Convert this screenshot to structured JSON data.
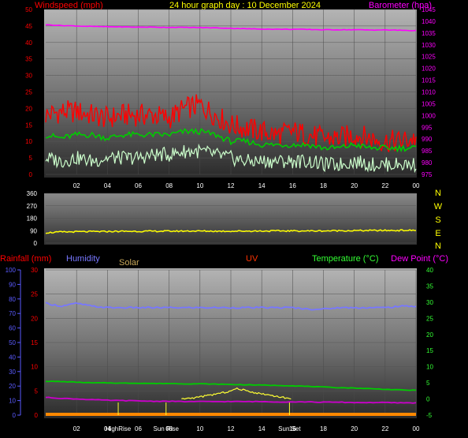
{
  "header": {
    "title": "24 hour graph day : 10 December 2024",
    "windspeed_label": "Windspeed (mph)",
    "barometer_label": "Barometer (hpa)"
  },
  "direction_letters": [
    "N",
    "W",
    "S",
    "E",
    "N"
  ],
  "lower_header": {
    "rainfall": "Rainfall (mm)",
    "humidity": "Humidity",
    "solar": "Solar",
    "uv": "UV",
    "temperature": "Temperature (°C)",
    "dewpoint": "Dew Point (°C)"
  },
  "colors": {
    "windspeed": "#ff0000",
    "gust": "#ff0000",
    "wind_avg": "#00cc00",
    "wind_low": "#ccffcc",
    "barometer": "#ff00ff",
    "direction": "#ffff00",
    "humidity": "#7777ff",
    "temperature": "#00cc00",
    "dewpoint": "#cc00cc",
    "solar": "#ffff33",
    "uv": "#ff0000",
    "rain": "#ff8800",
    "header_title": "#ffff00",
    "axis_tick": "#ffffff"
  },
  "x_ticks": [
    "02",
    "04",
    "06",
    "08",
    "10",
    "12",
    "14",
    "16",
    "18",
    "20",
    "22",
    "00"
  ],
  "chart_data": [
    {
      "type": "line",
      "title": "24 hour graph day : 10 December 2024",
      "ylabel_left": "Windspeed (mph)",
      "ylabel_right": "Barometer (hpa)",
      "ylim_left": [
        0,
        50
      ],
      "ylim_right": [
        975,
        1045
      ],
      "left_ticks": [
        0,
        5,
        10,
        15,
        20,
        25,
        30,
        35,
        40,
        45,
        50
      ],
      "right_ticks": [
        975,
        980,
        985,
        990,
        995,
        1000,
        1005,
        1010,
        1015,
        1020,
        1025,
        1030,
        1035,
        1040,
        1045
      ],
      "x_hours": [
        0,
        1,
        2,
        3,
        4,
        5,
        6,
        7,
        8,
        9,
        10,
        11,
        12,
        13,
        14,
        15,
        16,
        17,
        18,
        19,
        20,
        21,
        22,
        23,
        24
      ],
      "series": [
        {
          "values": [
            18,
            19,
            19,
            18,
            17,
            18,
            18,
            18,
            17,
            20,
            21,
            18,
            15,
            14,
            13,
            12,
            13,
            12,
            11,
            11,
            12,
            11,
            10,
            10,
            11
          ]
        },
        {
          "values": [
            12,
            11,
            12,
            12,
            11,
            12,
            12,
            12,
            12,
            13,
            13,
            12,
            10,
            10,
            9,
            9,
            9,
            9,
            8,
            8,
            9,
            8,
            8,
            8,
            8
          ]
        },
        {
          "values": [
            5,
            4,
            5,
            4,
            5,
            5,
            5,
            6,
            6,
            7,
            7,
            6,
            5,
            4,
            4,
            4,
            4,
            4,
            3,
            3,
            4,
            3,
            3,
            3,
            3
          ]
        },
        {
          "values": [
            1038.5,
            1038.2,
            1038.0,
            1037.8,
            1037.7,
            1037.6,
            1037.5,
            1037.5,
            1037.4,
            1037.4,
            1037.3,
            1037.2,
            1037.0,
            1036.8,
            1036.7,
            1036.6,
            1036.6,
            1036.5,
            1036.4,
            1036.4,
            1036.4,
            1036.3,
            1036.3,
            1036.2,
            1036.0
          ]
        }
      ]
    },
    {
      "type": "line",
      "ylim": [
        0,
        360
      ],
      "ticks": [
        0,
        90,
        180,
        270,
        360
      ],
      "x_hours": [
        0,
        1,
        2,
        3,
        4,
        5,
        6,
        7,
        8,
        9,
        10,
        11,
        12,
        13,
        14,
        15,
        16,
        17,
        18,
        19,
        20,
        21,
        22,
        23,
        24
      ],
      "series": [
        {
          "values": [
            75,
            80,
            82,
            83,
            84,
            85,
            85,
            86,
            86,
            87,
            87,
            86,
            86,
            87,
            87,
            88,
            88,
            88,
            88,
            90,
            90,
            91,
            91,
            92,
            92
          ]
        }
      ]
    },
    {
      "type": "line",
      "axes": {
        "humidity": {
          "ylim": [
            0,
            100
          ],
          "ticks": [
            0,
            10,
            20,
            30,
            40,
            50,
            60,
            70,
            80,
            90,
            100
          ]
        },
        "rainfall": {
          "ylim": [
            0,
            30
          ],
          "ticks": [
            0,
            5,
            10,
            15,
            20,
            25,
            30
          ]
        },
        "temperature": {
          "ylim": [
            -5,
            40
          ],
          "ticks": [
            -5,
            0,
            5,
            10,
            15,
            20,
            25,
            30,
            35,
            40
          ]
        }
      },
      "x_hours": [
        0,
        1,
        2,
        3,
        4,
        5,
        6,
        7,
        8,
        9,
        10,
        11,
        12,
        13,
        14,
        15,
        16,
        17,
        18,
        19,
        20,
        21,
        22,
        23,
        24
      ],
      "series": [
        {
          "values": [
            77,
            75,
            77,
            75,
            74,
            74,
            74,
            74,
            74,
            74,
            74,
            74,
            74,
            74,
            74,
            74,
            74,
            73,
            73,
            74,
            74,
            74,
            74,
            75,
            75
          ]
        },
        {
          "values": [
            5.5,
            5.4,
            5.2,
            5.0,
            5.0,
            4.9,
            4.9,
            4.8,
            4.8,
            4.7,
            4.7,
            4.6,
            4.5,
            4.4,
            4.3,
            4.2,
            4.1,
            3.9,
            3.7,
            3.5,
            3.4,
            3.2,
            3.0,
            2.8,
            2.7
          ]
        },
        {
          "values": [
            0.5,
            0.2,
            0.0,
            -0.2,
            -0.4,
            -0.5,
            -0.6,
            -0.7,
            -0.7,
            -0.8,
            -0.8,
            -0.8,
            -0.8,
            -0.8,
            -0.8,
            -0.9,
            -0.9,
            -0.9,
            -1.0,
            -1.0,
            -1.1,
            -1.1,
            -1.1,
            -1.2,
            -1.2
          ]
        }
      ],
      "solar": {
        "x_hours": [
          8.8,
          9.5,
          10.2,
          11.0,
          11.8,
          12.4,
          13.0,
          13.6,
          14.3,
          15.0,
          15.6,
          15.9
        ],
        "values": [
          0,
          0.3,
          0.8,
          1.5,
          2.2,
          3.2,
          2.6,
          1.9,
          1.4,
          0.8,
          0.3,
          0
        ]
      },
      "sun_events": [
        {
          "label": "HighRise",
          "hour": 4.7
        },
        {
          "label": "Sun Rise",
          "hour": 7.8
        },
        {
          "label": "Sun Set",
          "hour": 15.8
        }
      ]
    }
  ]
}
